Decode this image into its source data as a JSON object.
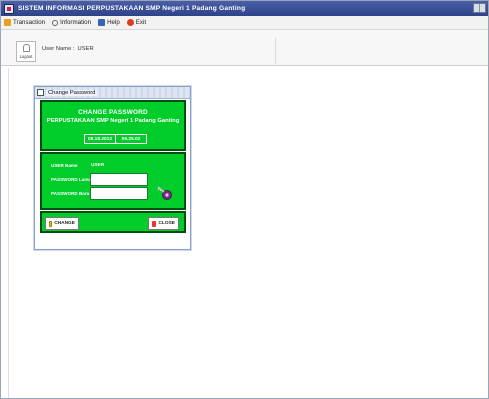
{
  "window": {
    "title": "SISTEM INFORMASI PERPUSTAKAAN SMP Negeri 1 Padang Ganting"
  },
  "menu": {
    "items": [
      {
        "label": "Transaction",
        "icon": "transaction-icon"
      },
      {
        "label": "Information",
        "icon": "information-icon"
      },
      {
        "label": "Help",
        "icon": "help-icon"
      },
      {
        "label": "Exit",
        "icon": "exit-icon"
      }
    ]
  },
  "toolbar": {
    "logout_label": "Logout",
    "user_caption": "User Name :",
    "user_name": "USER"
  },
  "dialog": {
    "title": "Change Password",
    "heading": "CHANGE PASSWORD",
    "subheading": "PERPUSTAKAAN SMP Negeri 1 Padang Ganting",
    "date": "08.18.2012",
    "time": "09.25.02",
    "user_label": "USER Name",
    "user_value": "USER",
    "old_password_label": "PASSWORD Lama",
    "new_password_label": "PASSWORD Baru",
    "change_button": "CHANGE",
    "close_button": "CLOSE"
  },
  "colors": {
    "panel_green": "#00cc2a",
    "panel_border": "#004d0f",
    "titlebar": "#2e4288"
  }
}
